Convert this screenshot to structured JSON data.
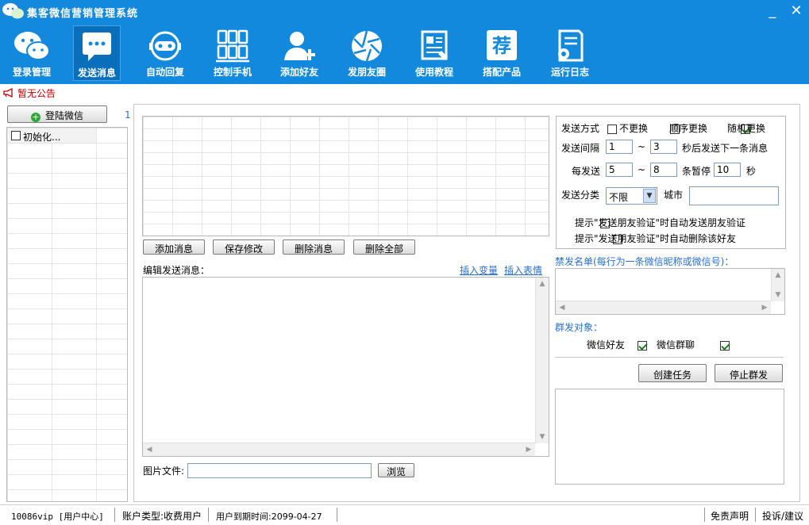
{
  "window": {
    "title": "集客微信营销管理系统",
    "minimize": "_",
    "close": "✕"
  },
  "toolbar": [
    {
      "label": "登录管理",
      "icon": "wechat-login-icon",
      "active": false
    },
    {
      "label": "发送消息",
      "icon": "message-icon",
      "active": true
    },
    {
      "label": "自动回复",
      "icon": "robot-icon",
      "active": false
    },
    {
      "label": "控制手机",
      "icon": "phones-icon",
      "active": false
    },
    {
      "label": "添加好友",
      "icon": "add-user-icon",
      "active": false
    },
    {
      "label": "发朋友圈",
      "icon": "moments-icon",
      "active": false
    },
    {
      "label": "使用教程",
      "icon": "tutorial-icon",
      "active": false
    },
    {
      "label": "搭配产品",
      "icon": "product-icon",
      "active": false
    },
    {
      "label": "运行日志",
      "icon": "log-icon",
      "active": false
    }
  ],
  "product_icon_char": "荐",
  "notice": "暂无公告",
  "left": {
    "login_button": "登陆微信",
    "count": "1",
    "accounts": [
      "初始化..."
    ]
  },
  "messages": {
    "add": "添加消息",
    "save": "保存修改",
    "delete": "删除消息",
    "delete_all": "删除全部",
    "edit_label": "编辑发送消息：",
    "insert_var": "插入变量",
    "insert_emoji": "插入表情",
    "image_label": "图片文件:",
    "browse": "浏览"
  },
  "settings": {
    "send_mode_label": "发送方式",
    "modes": [
      {
        "label": "不更换",
        "checked": false
      },
      {
        "label": "顺序更换",
        "checked": false
      },
      {
        "label": "随机更换",
        "checked": true
      }
    ],
    "interval_label": "发送间隔",
    "interval_min": "1",
    "interval_max": "3",
    "interval_suffix": "秒后发送下一条消息",
    "tilde": "~",
    "per_send_label": "每发送",
    "per_min": "5",
    "per_max": "8",
    "pause_label": "条暂停",
    "pause_value": "10",
    "pause_suffix": "秒",
    "category_label": "发送分类",
    "category_value": "不限",
    "city_label": "城市",
    "city_value": "",
    "tip1": "提示\"发送朋友验证\"时自动发送朋友验证",
    "tip2": "提示\"发送朋友验证\"时自动删除该好友"
  },
  "blacklist_label": "禁发名单(每行为一条微信昵称或微信号)：",
  "targets": {
    "label": "群发对象：",
    "friends": "微信好友",
    "groups": "微信群聊",
    "friends_checked": true,
    "groups_checked": true
  },
  "actions": {
    "create": "创建任务",
    "stop": "停止群发"
  },
  "status": {
    "account": "10086vip [用户中心]",
    "type": "账户类型:收费用户",
    "expire": "用户到期时间:2099-04-27",
    "disclaimer": "免责声明",
    "feedback": "投诉/建议"
  },
  "colors": {
    "toolbar": "#1289dc",
    "active_tab": "#0a6fba",
    "notice": "#c00000",
    "link": "#2a6fc9"
  }
}
